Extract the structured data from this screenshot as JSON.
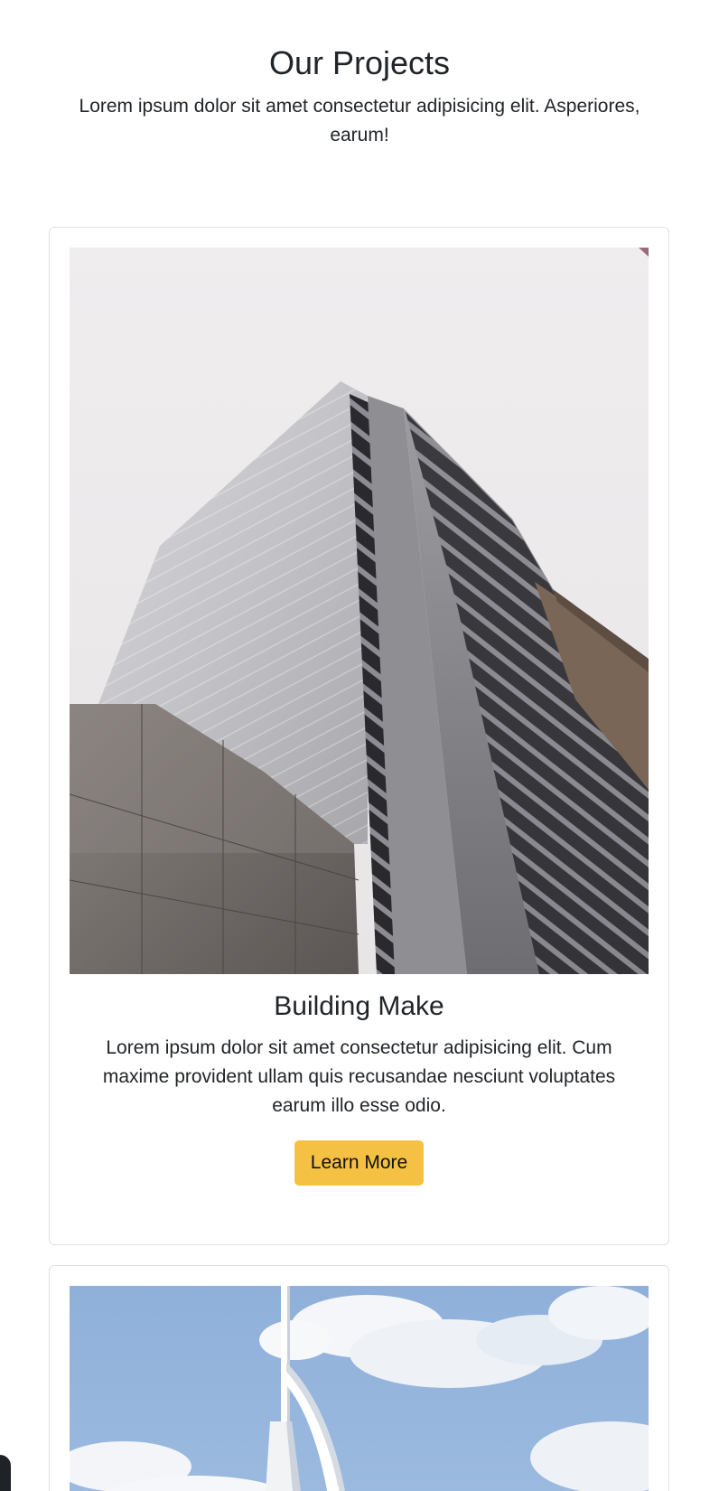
{
  "header": {
    "title": "Our Projects",
    "subtitle": "Lorem ipsum dolor sit amet consectetur adipisicing elit. Asperiores, earum!"
  },
  "projects": [
    {
      "title": "Building Make",
      "text": "Lorem ipsum dolor sit amet consectetur adipisicing elit. Cum maxime provident ullam quis recusandae nesciunt voluptates earum illo esse odio.",
      "button_label": "Learn More",
      "image": "high-rise-office-building-photo"
    },
    {
      "image": "sail-shaped-tower-against-blue-sky-photo"
    }
  ],
  "colors": {
    "button": "#f5c142",
    "card_border": "#dfe1e4",
    "text": "#212529"
  }
}
